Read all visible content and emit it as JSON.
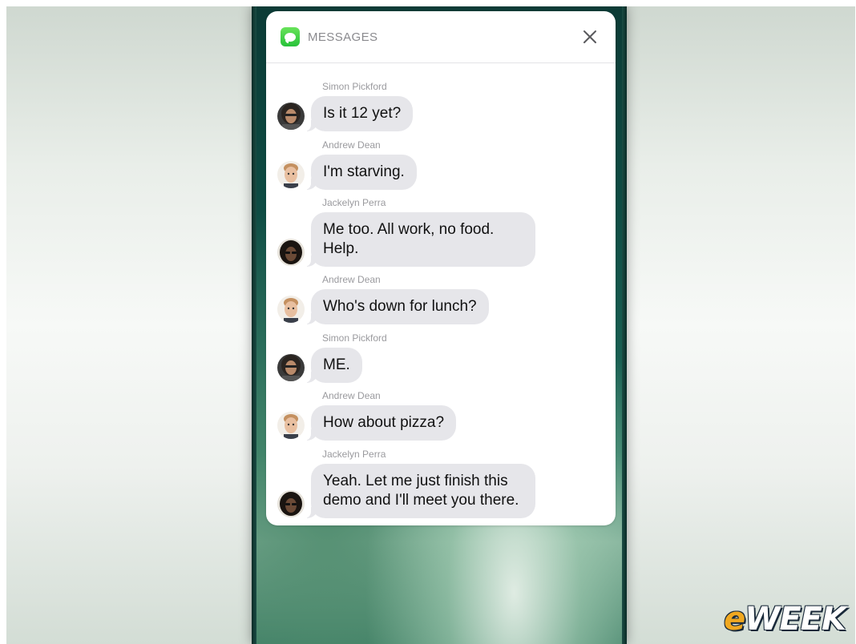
{
  "notification": {
    "app_name": "MESSAGES",
    "app_icon": "messages-icon",
    "close_icon": "close-icon",
    "accent": "#34c759"
  },
  "messages": [
    {
      "sender": "Simon Pickford",
      "text": "Is it 12 yet?",
      "avatar": "avatar-simon"
    },
    {
      "sender": "Andrew Dean",
      "text": "I'm starving.",
      "avatar": "avatar-andrew"
    },
    {
      "sender": "Jackelyn Perra",
      "text": "Me too. All work, no food. Help.",
      "avatar": "avatar-jackelyn"
    },
    {
      "sender": "Andrew Dean",
      "text": "Who's down for lunch?",
      "avatar": "avatar-andrew"
    },
    {
      "sender": "Simon Pickford",
      "text": "ME.",
      "avatar": "avatar-simon"
    },
    {
      "sender": "Andrew Dean",
      "text": "How about pizza?",
      "avatar": "avatar-andrew"
    },
    {
      "sender": "Jackelyn Perra",
      "text": "Yeah. Let me just finish this demo and I'll meet you there.",
      "avatar": "avatar-jackelyn"
    }
  ],
  "watermark": {
    "prefix": "e",
    "rest": "WEEK"
  }
}
